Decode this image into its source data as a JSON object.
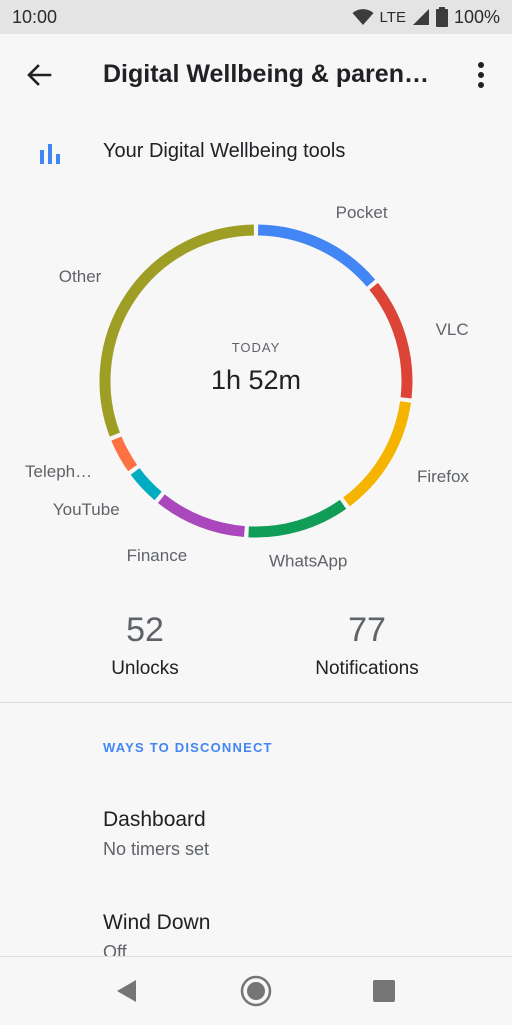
{
  "status_bar": {
    "time": "10:00",
    "network": "LTE",
    "battery": "100%",
    "icons": [
      "wifi-icon",
      "signal-icon",
      "battery-icon"
    ]
  },
  "app_bar": {
    "title": "Digital Wellbeing & paren…",
    "back_icon": "arrow-back-icon",
    "more_icon": "more-vert-icon"
  },
  "tools_header": {
    "icon": "bar-chart-icon",
    "label": "Your Digital Wellbeing tools"
  },
  "chart_data": {
    "type": "pie",
    "center_label": "TODAY",
    "center_value": "1h 52m",
    "categories": [
      "Pocket",
      "VLC",
      "Firefox",
      "WhatsApp",
      "Finance",
      "YouTube",
      "Teleph…",
      "Other"
    ],
    "values": [
      14,
      13,
      13,
      11,
      10,
      4,
      4,
      31
    ],
    "colors": [
      "#4285f4",
      "#db4437",
      "#f4b400",
      "#0f9d58",
      "#ab47bc",
      "#00acc1",
      "#ff7043",
      "#9e9d24"
    ]
  },
  "stats": {
    "unlocks_value": "52",
    "unlocks_label": "Unlocks",
    "notifications_value": "77",
    "notifications_label": "Notifications"
  },
  "section": {
    "header": "WAYS TO DISCONNECT"
  },
  "items": [
    {
      "title": "Dashboard",
      "subtitle": "No timers set"
    },
    {
      "title": "Wind Down",
      "subtitle": "Off"
    }
  ],
  "nav_bar": {
    "back": "nav-back-icon",
    "home": "nav-home-icon",
    "recents": "nav-recents-icon"
  },
  "colors": {
    "accent": "#4285f4",
    "background": "#f7f7f7"
  }
}
